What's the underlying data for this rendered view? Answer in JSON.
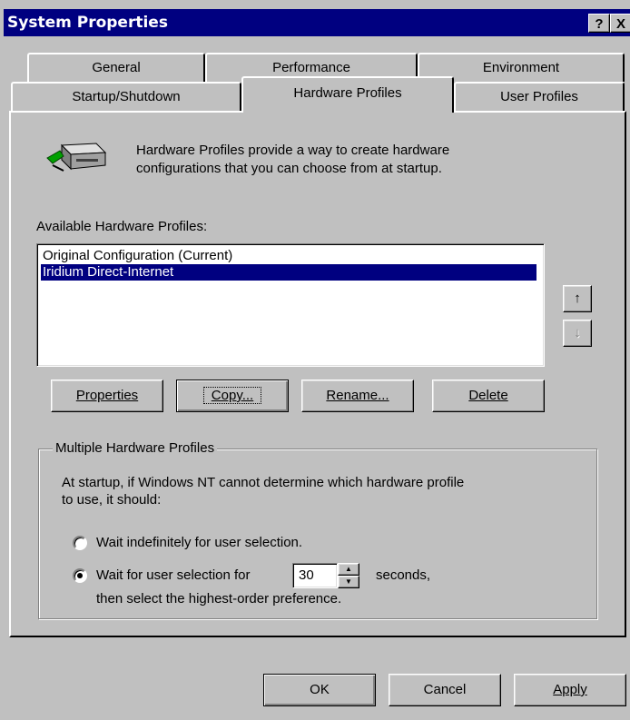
{
  "window": {
    "title": "System Properties",
    "help_button": "?",
    "close_button": "X"
  },
  "tabs": {
    "row1": [
      "General",
      "Performance",
      "Environment"
    ],
    "row2": [
      "Startup/Shutdown",
      "Hardware Profiles",
      "User Profiles"
    ],
    "active": "Hardware Profiles"
  },
  "intro": {
    "line1": "Hardware Profiles provide a way to create hardware",
    "line2": "configurations that you can choose from at startup."
  },
  "profiles": {
    "label": "Available Hardware Profiles:",
    "items": [
      "Original Configuration (Current)",
      "Iridium Direct-Internet"
    ],
    "selected_index": 1,
    "move_up": "↑",
    "move_down": "↓"
  },
  "actions": {
    "properties": "Properties",
    "copy": "Copy...",
    "rename": "Rename...",
    "delete": "Delete"
  },
  "multiple": {
    "group_label": "Multiple Hardware Profiles",
    "desc_line1": "At startup, if Windows NT cannot determine which hardware profile",
    "desc_line2": "to use, it should:",
    "option_wait_indef": "Wait indefinitely for user selection.",
    "option_wait_for": "Wait for user selection for",
    "seconds_value": "30",
    "seconds_label": "seconds,",
    "then_line": "then select the highest-order preference.",
    "selected_option": "wait_for"
  },
  "footer": {
    "ok": "OK",
    "cancel": "Cancel",
    "apply": "Apply"
  },
  "colors": {
    "titlebar": "#000080",
    "face": "#c0c0c0",
    "selection": "#000080"
  }
}
